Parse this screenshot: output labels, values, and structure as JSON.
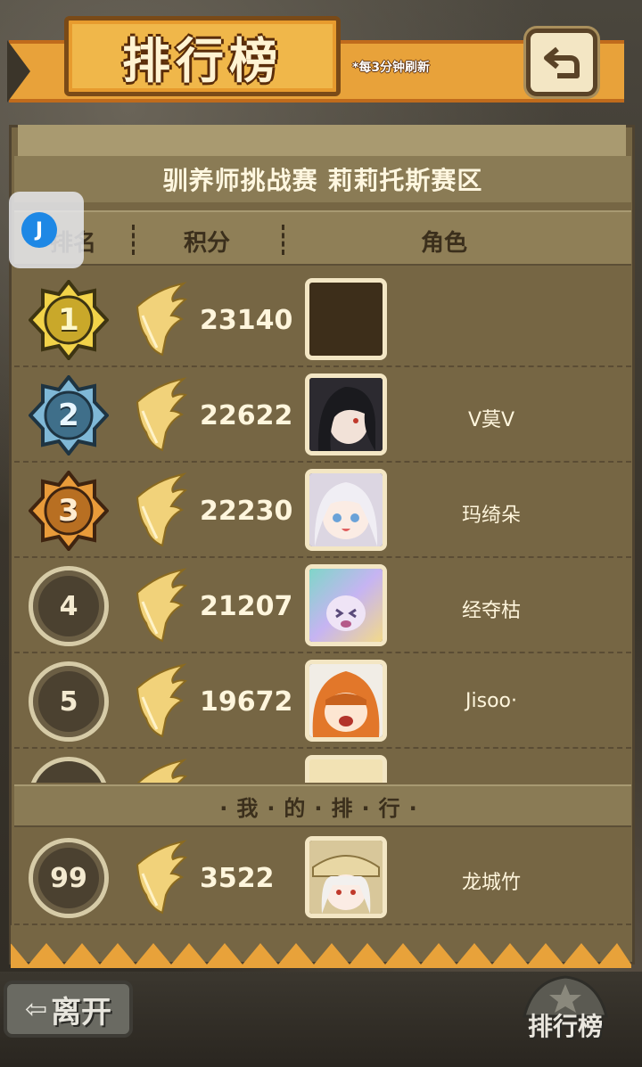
{
  "header": {
    "title": "排行榜",
    "refresh_note": "*每3分钟刷新"
  },
  "panel": {
    "subtitle": "驯养师挑战赛 莉莉托斯赛区",
    "columns": {
      "rank": "排名",
      "score": "积分",
      "role": "角色"
    }
  },
  "overlay": {
    "glyph": "J"
  },
  "rows": [
    {
      "rank": "1",
      "score": "23140",
      "name": ""
    },
    {
      "rank": "2",
      "score": "22622",
      "name": "V莫V"
    },
    {
      "rank": "3",
      "score": "22230",
      "name": "玛绮朵"
    },
    {
      "rank": "4",
      "score": "21207",
      "name": "经夺枯"
    },
    {
      "rank": "5",
      "score": "19672",
      "name": "Jisoo·"
    }
  ],
  "mine": {
    "label": "·我·的·排·行·",
    "rank": "99",
    "score": "3522",
    "name": "龙城竹"
  },
  "footer": {
    "leave_label": "离开",
    "rank_label": "排行榜"
  },
  "colors": {
    "gold": "#f2d349",
    "silver": "#7fb8d6",
    "bronze": "#e99b3a",
    "plain": "#4b4130"
  }
}
